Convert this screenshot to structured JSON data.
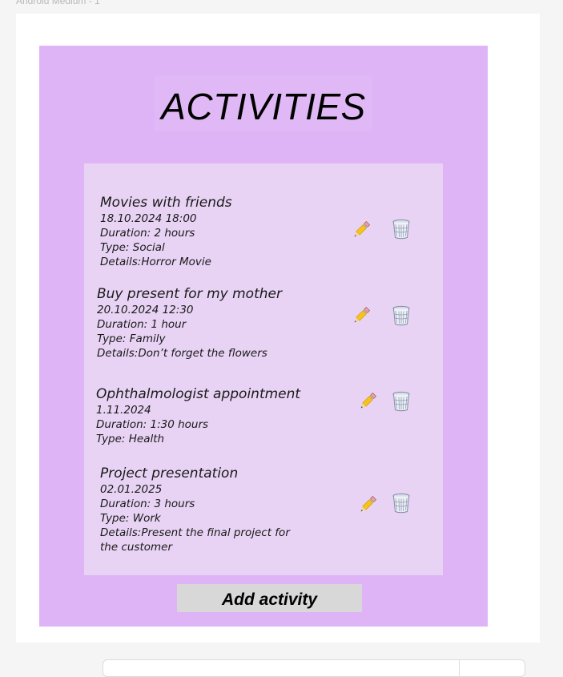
{
  "frame": {
    "label": "Android Medium - 1"
  },
  "header": {
    "title": "ACTIVITIES"
  },
  "activities": [
    {
      "title": "Movies with friends",
      "datetime": "18.10.2024  18:00",
      "duration": "Duration: 2 hours",
      "type": "Type: Social",
      "details": "Details:Horror Movie"
    },
    {
      "title": "Buy present for my mother",
      "datetime": "20.10.2024  12:30",
      "duration": "Duration: 1 hour",
      "type": "Type: Family",
      "details": "Details:Don’t forget the flowers"
    },
    {
      "title": "Ophthalmologist appointment",
      "datetime": "1.11.2024",
      "duration": "Duration: 1:30 hours",
      "type": "Type: Health"
    },
    {
      "title": "Project presentation",
      "datetime": "02.01.2025",
      "duration": "Duration: 3 hours",
      "type": "Type: Work",
      "details": "Details:Present the final project for the customer"
    }
  ],
  "icons": {
    "edit": "pencil-icon",
    "delete": "wastebasket-icon"
  },
  "footer": {
    "add_label": "Add activity"
  },
  "colors": {
    "canvas": "#f5f5f5",
    "artboard": "#ffffff",
    "phone_background": "#deb4f7",
    "list_background": "#e8d3f4",
    "button_background": "#d8d8d8"
  }
}
